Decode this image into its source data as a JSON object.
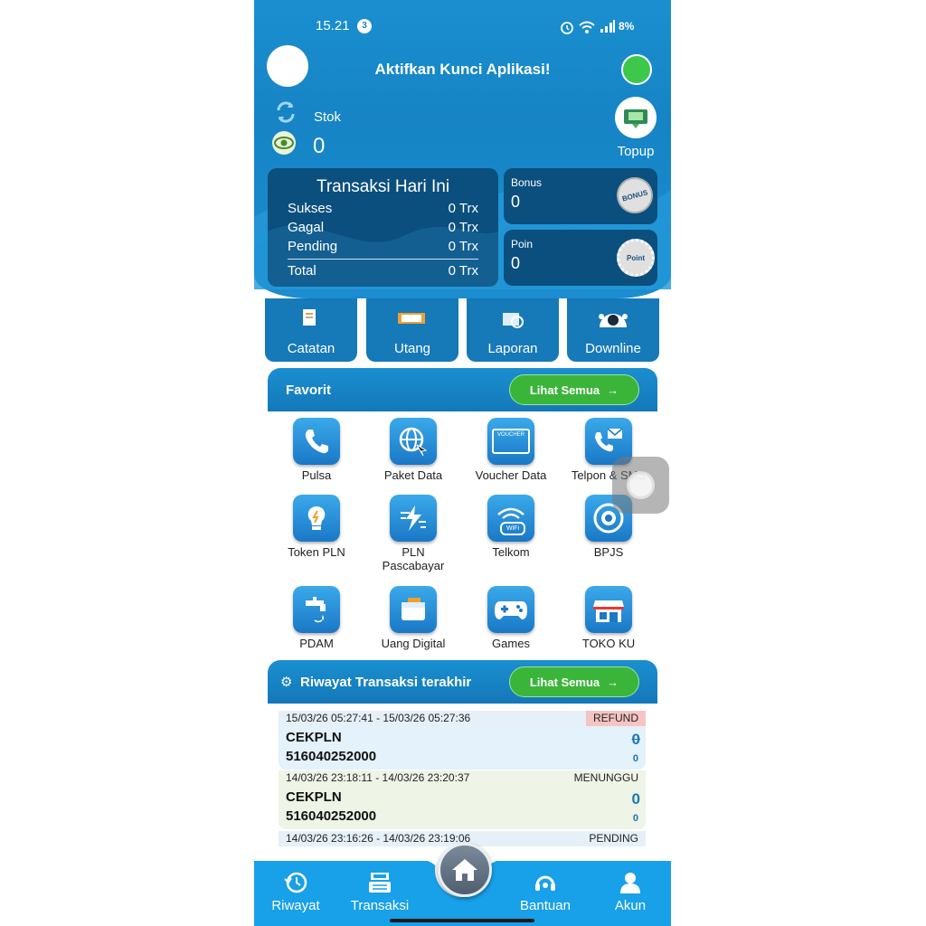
{
  "status_bar": {
    "time": "15.21",
    "notif_count": "3",
    "battery": "8%"
  },
  "header": {
    "app_lock_text": "Aktifkan Kunci Aplikasi!"
  },
  "stock": {
    "label": "Stok",
    "value": "0"
  },
  "topup": {
    "label": "Topup"
  },
  "today": {
    "title": "Transaksi Hari Ini",
    "rows": [
      {
        "label": "Sukses",
        "value": "0 Trx"
      },
      {
        "label": "Gagal",
        "value": "0 Trx"
      },
      {
        "label": "Pending",
        "value": "0 Trx"
      }
    ],
    "total_label": "Total",
    "total_value": "0 Trx"
  },
  "bonus": {
    "label": "Bonus",
    "value": "0",
    "badge": "BONUS"
  },
  "poin": {
    "label": "Poin",
    "value": "0",
    "badge": "Point"
  },
  "quick": [
    {
      "label": "Catatan"
    },
    {
      "label": "Utang"
    },
    {
      "label": "Laporan"
    },
    {
      "label": "Downline"
    }
  ],
  "favorit": {
    "title": "Favorit",
    "see_all": "Lihat Semua",
    "items": [
      {
        "label": "Pulsa",
        "icon": "phone-icon"
      },
      {
        "label": "Paket Data",
        "icon": "globe-icon"
      },
      {
        "label": "Voucher Data",
        "icon": "voucher-icon",
        "sub": "VOUCHER"
      },
      {
        "label": "Telpon & SMS",
        "icon": "phone-mail-icon"
      },
      {
        "label": "Token PLN",
        "icon": "bulb-icon"
      },
      {
        "label": "PLN Pascabayar",
        "label_line1": "PLN",
        "label_line2": "Pascabayar",
        "icon": "lightning-icon"
      },
      {
        "label": "Telkom",
        "icon": "wifi-icon",
        "sub": "WiFi"
      },
      {
        "label": "BPJS",
        "icon": "bpjs-icon"
      },
      {
        "label": "PDAM",
        "icon": "faucet-icon"
      },
      {
        "label": "Uang Digital",
        "icon": "wallet-icon"
      },
      {
        "label": "Games",
        "icon": "gamepad-icon"
      },
      {
        "label": "TOKO KU",
        "icon": "shop-icon"
      }
    ]
  },
  "history": {
    "title": "Riwayat Transaksi terakhir",
    "see_all": "Lihat Semua",
    "items": [
      {
        "time": "15/03/26 05:27:41 - 15/03/26 05:27:36",
        "status": "REFUND",
        "name": "CEKPLN",
        "number": "516040252000",
        "amount": "0",
        "fee": "0"
      },
      {
        "time": "14/03/26 23:18:11 - 14/03/26 23:20:37",
        "status": "MENUNGGU",
        "name": "CEKPLN",
        "number": "516040252000",
        "amount": "0",
        "fee": "0"
      },
      {
        "time": "14/03/26 23:16:26 - 14/03/26 23:19:06",
        "status": "PENDING"
      }
    ]
  },
  "nav": {
    "items": [
      {
        "label": "Riwayat"
      },
      {
        "label": "Transaksi"
      },
      {
        "label": "Bantuan"
      },
      {
        "label": "Akun"
      }
    ]
  },
  "colors": {
    "primary": "#1a8fd0",
    "card": "#0b4f7e",
    "green": "#3ab53a",
    "refund": "#f5c4c4"
  }
}
